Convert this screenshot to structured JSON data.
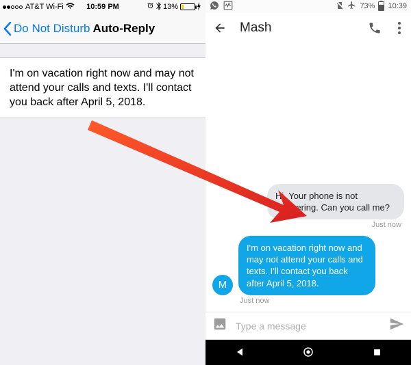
{
  "ios": {
    "status": {
      "carrier": "AT&T Wi-Fi",
      "time": "10:59 PM",
      "battery_pct": "13%"
    },
    "nav": {
      "back_label": "Do Not Disturb",
      "title": "Auto-Reply"
    },
    "autoreply_text": "I'm on vacation right now and may not attend your calls and texts. I'll contact you back after April 5, 2018."
  },
  "android": {
    "status": {
      "battery_pct": "73%",
      "time": "10:39"
    },
    "app": {
      "contact_name": "Mash"
    },
    "messages": {
      "incoming": {
        "text": "Hi. Your phone is not answering. Can you call me?",
        "timestamp": "Just now"
      },
      "outgoing": {
        "avatar_initial": "M",
        "text": "I'm on vacation right now and may not attend your calls and texts. I'll contact you back after April 5, 2018.",
        "timestamp": "Just now"
      }
    },
    "composer": {
      "placeholder": "Type a message"
    }
  }
}
